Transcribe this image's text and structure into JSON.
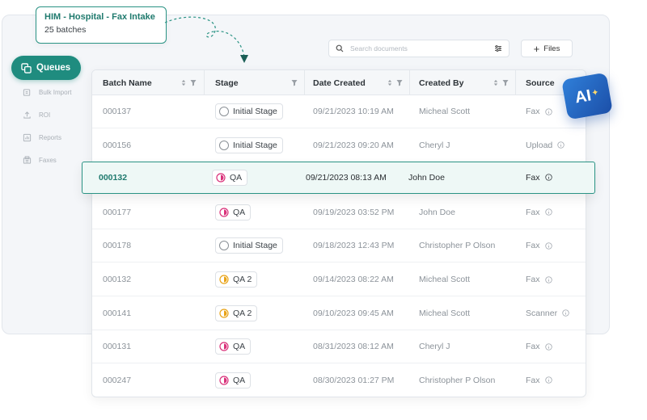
{
  "callout": {
    "title": "HIM - Hospital - Fax Intake",
    "subtitle": "25 batches"
  },
  "sidebar": {
    "active": "Queues",
    "items": [
      {
        "label": "Bulk Import",
        "icon": "bulk-import-icon"
      },
      {
        "label": "ROI",
        "icon": "upload-icon"
      },
      {
        "label": "Reports",
        "icon": "chart-icon"
      },
      {
        "label": "Faxes",
        "icon": "fax-icon"
      }
    ]
  },
  "search": {
    "placeholder": "Search documents",
    "value": ""
  },
  "files_button": {
    "label": "Files"
  },
  "ai_badge": {
    "label": "AI"
  },
  "table": {
    "columns": [
      "Batch Name",
      "Stage",
      "Date Created",
      "Created By",
      "Source"
    ],
    "rows": [
      {
        "batch": "000137",
        "stage": "Initial Stage",
        "stage_type": "initial",
        "date": "09/21/2023 10:19 AM",
        "by": "Micheal Scott",
        "source": "Fax"
      },
      {
        "batch": "000156",
        "stage": "Initial Stage",
        "stage_type": "initial",
        "date": "09/21/2023 09:20 AM",
        "by": "Cheryl J",
        "source": "Upload"
      },
      {
        "batch": "000132",
        "stage": "QA",
        "stage_type": "qa",
        "date": "09/21/2023 08:13 AM",
        "by": "John Doe",
        "source": "Fax",
        "highlighted": true
      },
      {
        "batch": "000177",
        "stage": "QA",
        "stage_type": "qa",
        "date": "09/19/2023 03:52 PM",
        "by": "John Doe",
        "source": "Fax"
      },
      {
        "batch": "000178",
        "stage": "Initial Stage",
        "stage_type": "initial",
        "date": "09/18/2023 12:43 PM",
        "by": "Christopher P Olson",
        "source": "Fax"
      },
      {
        "batch": "000132",
        "stage": "QA 2",
        "stage_type": "qa2",
        "date": "09/14/2023 08:22 AM",
        "by": "Micheal Scott",
        "source": "Fax"
      },
      {
        "batch": "000141",
        "stage": "QA 2",
        "stage_type": "qa2",
        "date": "09/10/2023 09:45 AM",
        "by": "Micheal Scott",
        "source": "Scanner"
      },
      {
        "batch": "000131",
        "stage": "QA",
        "stage_type": "qa",
        "date": "08/31/2023 08:12 AM",
        "by": "Cheryl J",
        "source": "Fax"
      },
      {
        "batch": "000247",
        "stage": "QA",
        "stage_type": "qa",
        "date": "08/30/2023 01:27 PM",
        "by": "Christopher P Olson",
        "source": "Fax"
      }
    ]
  },
  "colors": {
    "accent": "#1f8c7f",
    "qa": "#d9317a",
    "qa2": "#e8a317",
    "ai": "#1c4fa8"
  }
}
